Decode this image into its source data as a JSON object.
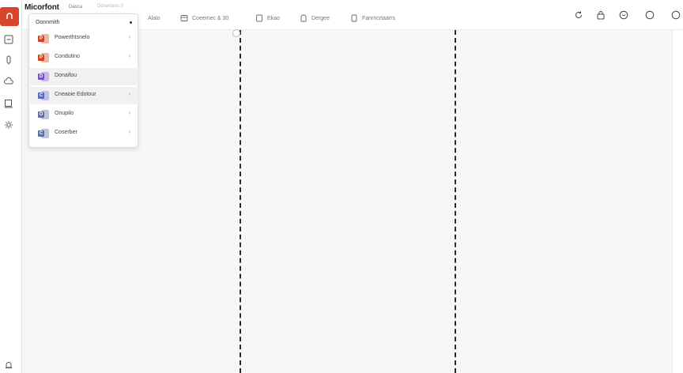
{
  "app": {
    "brand": "Micorfont",
    "brand_sub": "Dasca",
    "brand_sub2": "Dorantanu   0"
  },
  "tabs": [
    {
      "label": "Alalo",
      "icon": "none"
    },
    {
      "label": "Coeemec & 30",
      "icon": "frame-icon"
    },
    {
      "label": "Ekao",
      "icon": "page-icon"
    },
    {
      "label": "Dergee",
      "icon": "bookmark-icon"
    },
    {
      "label": "Fanrncrtaarrs",
      "icon": "doc-icon"
    }
  ],
  "topbar_right_icons": [
    "refresh-icon",
    "lock-icon",
    "emoji-icon",
    "circle-icon",
    "profile-icon"
  ],
  "rail_icons": [
    "app-logo-icon",
    "panel-icon",
    "pen-icon",
    "cloud-icon",
    "frame-icon",
    "gear-icon",
    "bell-icon"
  ],
  "menu": {
    "header": "Oonnmith",
    "items": [
      {
        "label": "Powerthtsnelo",
        "color": "#d3461f",
        "letter": "P",
        "highlighted": false
      },
      {
        "label": "Condutino",
        "color": "#d3461f",
        "letter": "P",
        "highlighted": false
      },
      {
        "label": "Donaifou",
        "color": "#7c4fc4",
        "letter": "D",
        "highlighted": true
      },
      {
        "label": "Cneaoie Edotour",
        "color": "#5968c8",
        "letter": "C",
        "highlighted": true
      },
      {
        "label": "Onupilo",
        "color": "#5f6fa8",
        "letter": "O",
        "highlighted": false
      },
      {
        "label": "Coserber",
        "color": "#5f6fa8",
        "letter": "C",
        "highlighted": false
      }
    ]
  },
  "colors": {
    "accent": "#d9452b",
    "divider": "#2a2a2a",
    "canvas": "#f7f7f8"
  }
}
